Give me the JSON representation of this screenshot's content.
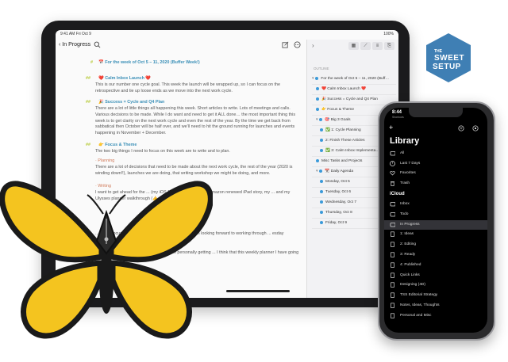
{
  "ipad": {
    "status_time": "9:41 AM",
    "status_date": "Fri Oct 9",
    "battery": "100%",
    "back_label": "In Progress",
    "editor_lines": [
      {
        "mark": "#",
        "text": "📅 For the week of Oct 5 – 11, 2020 (Buffer Week!)",
        "type": "h1"
      },
      {
        "mark": "##",
        "text": "❤️ Calm Inbox Launch ❤️",
        "type": "h2"
      },
      {
        "text": "This is our number one cycle goal. This week the launch will be wrapped up, so I can focus on the retrospective and tie up loose ends as we move into the next work cycle.",
        "type": "p"
      },
      {
        "mark": "##",
        "text": "🎉 Success = Cycle and Q4 Plan",
        "type": "h2"
      },
      {
        "text": "There are a lot of little things all happening this week. Short articles to write. Lots of meetings and calls. Various decisions to be made. While I do want and need to get it ALL done… the most important thing this week is to get clarity on the next work cycle and even the rest of the year. By the time we get back from sabbatical then October will be half over, and we'll need to hit the ground running for launches and events happening in November + December.",
        "type": "p"
      },
      {
        "mark": "##",
        "text": "👉 Focus & Theme",
        "type": "h2"
      },
      {
        "text": "The two big things I need to focus on this week are to write and to plan.",
        "type": "p"
      },
      {
        "text": "· Planning",
        "type": "sub"
      },
      {
        "text": "There are a lot of decisions that need to be made about the next work cycle, the rest of the year (2020 is winding down!!), launches we are doing, that writing workshop we might be doing, and more.",
        "type": "p"
      },
      {
        "text": "· Writing",
        "type": "sub"
      },
      {
        "text": "I want to get ahead for the ... (my iOS 14 Home Screen, my Amazon renewed iPad story, my ... and my Ulysses planner walkthrough (👍 ... hit everyone!)).",
        "type": "p"
      },
      {
        "text": "... super focused on Delegation! How can I ... bility). I'm looking forward to working through ... esday meetings",
        "type": "p"
      },
      {
        "text": "... our team's project management tool. I'm personally getting ... I think that this weekly planner I have going on in",
        "type": "p"
      }
    ],
    "outline_label": "OUTLINE",
    "outline": [
      {
        "text": "For the week of Oct 5 – 11, 2020 (Buff…",
        "indent": 0,
        "arrow": true
      },
      {
        "text": "❤️ Calm Inbox Launch ❤️",
        "indent": 1
      },
      {
        "text": "🎉 Success = Cycle and Q4 Plan",
        "indent": 1
      },
      {
        "text": "👉 Focus & Theme",
        "indent": 1
      },
      {
        "text": "🎯 Big 3 Goals",
        "indent": 1,
        "arrow": true
      },
      {
        "text": "✅ 1: Cycle Planning",
        "indent": 2
      },
      {
        "text": "2: Finish These Articles",
        "indent": 2
      },
      {
        "text": "✅ 3: Calm Inbox Implementa…",
        "indent": 2
      },
      {
        "text": "Misc Tasks and Projects",
        "indent": 1
      },
      {
        "text": "📆 Daily Agenda",
        "indent": 1,
        "arrow": true
      },
      {
        "text": "Monday, Oct 5",
        "indent": 2
      },
      {
        "text": "Tuesday, Oct 6",
        "indent": 2
      },
      {
        "text": "Wednesday, Oct 7",
        "indent": 2
      },
      {
        "text": "Thursday, Oct 8",
        "indent": 2
      },
      {
        "text": "Friday, Oct 9",
        "indent": 2
      }
    ]
  },
  "iphone": {
    "time": "8:44",
    "subtitle": "Shortcuts",
    "title": "Library",
    "icloud_label": "iCloud",
    "items_top": [
      "All",
      "Last 7 Days",
      "Favorites",
      "Trash"
    ],
    "items_icloud": [
      "Inbox",
      "Todo",
      "In Progress",
      "1: Ideas",
      "2: Editing",
      "3: Ready",
      "4: Published",
      "Quick Links",
      "Designing (4D)",
      "TSS Editorial Strategy",
      "Notes, Ideas, Thoughts",
      "Personal and Misc"
    ],
    "selected": "In Progress"
  },
  "badge": {
    "line1": "THE",
    "line2": "SWEET",
    "line3": "SETUP",
    "color": "#3f7fb4"
  },
  "colors": {
    "heading": "#3a8fb7",
    "butterfly_yellow": "#f4c41f",
    "butterfly_black": "#1a1a1a"
  }
}
